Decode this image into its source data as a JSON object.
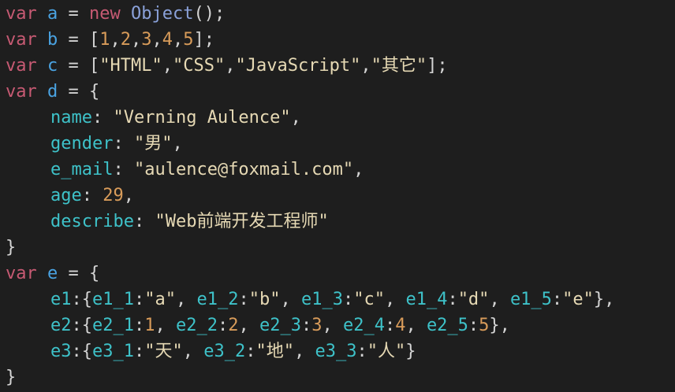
{
  "editor": {
    "background": "#1e1e1e",
    "colors": {
      "keyword": "#c75a73",
      "identifier": "#4aa3e2",
      "property": "#3ec2c9",
      "string": "#e6d9b4",
      "number": "#d99c5a",
      "punctuation": "#d4d4d4",
      "class": "#8aa1d9"
    },
    "lines": [
      {
        "indent": 0,
        "tokens": [
          {
            "t": "keyword",
            "v": "var"
          },
          {
            "t": "plain",
            "v": " "
          },
          {
            "t": "ident",
            "v": "a"
          },
          {
            "t": "plain",
            "v": " "
          },
          {
            "t": "punct",
            "v": "="
          },
          {
            "t": "plain",
            "v": " "
          },
          {
            "t": "keyword",
            "v": "new"
          },
          {
            "t": "plain",
            "v": " "
          },
          {
            "t": "class",
            "v": "Object"
          },
          {
            "t": "punct",
            "v": "();"
          }
        ]
      },
      {
        "indent": 0,
        "tokens": [
          {
            "t": "keyword",
            "v": "var"
          },
          {
            "t": "plain",
            "v": " "
          },
          {
            "t": "ident",
            "v": "b"
          },
          {
            "t": "plain",
            "v": " "
          },
          {
            "t": "punct",
            "v": "="
          },
          {
            "t": "plain",
            "v": " "
          },
          {
            "t": "punct",
            "v": "["
          },
          {
            "t": "number",
            "v": "1"
          },
          {
            "t": "punct",
            "v": ","
          },
          {
            "t": "number",
            "v": "2"
          },
          {
            "t": "punct",
            "v": ","
          },
          {
            "t": "number",
            "v": "3"
          },
          {
            "t": "punct",
            "v": ","
          },
          {
            "t": "number",
            "v": "4"
          },
          {
            "t": "punct",
            "v": ","
          },
          {
            "t": "number",
            "v": "5"
          },
          {
            "t": "punct",
            "v": "];"
          }
        ]
      },
      {
        "indent": 0,
        "tokens": [
          {
            "t": "keyword",
            "v": "var"
          },
          {
            "t": "plain",
            "v": " "
          },
          {
            "t": "ident",
            "v": "c"
          },
          {
            "t": "plain",
            "v": " "
          },
          {
            "t": "punct",
            "v": "="
          },
          {
            "t": "plain",
            "v": " "
          },
          {
            "t": "punct",
            "v": "["
          },
          {
            "t": "string",
            "v": "\"HTML\""
          },
          {
            "t": "punct",
            "v": ","
          },
          {
            "t": "string",
            "v": "\"CSS\""
          },
          {
            "t": "punct",
            "v": ","
          },
          {
            "t": "string",
            "v": "\"JavaScript\""
          },
          {
            "t": "punct",
            "v": ","
          },
          {
            "t": "string",
            "v": "\"其它\""
          },
          {
            "t": "punct",
            "v": "];"
          }
        ]
      },
      {
        "indent": 0,
        "tokens": [
          {
            "t": "keyword",
            "v": "var"
          },
          {
            "t": "plain",
            "v": " "
          },
          {
            "t": "ident",
            "v": "d"
          },
          {
            "t": "plain",
            "v": " "
          },
          {
            "t": "punct",
            "v": "="
          },
          {
            "t": "plain",
            "v": " "
          },
          {
            "t": "punct",
            "v": "{"
          }
        ]
      },
      {
        "indent": 1,
        "tokens": [
          {
            "t": "prop",
            "v": "name"
          },
          {
            "t": "punct",
            "v": ":"
          },
          {
            "t": "plain",
            "v": " "
          },
          {
            "t": "string",
            "v": "\"Verning Aulence\""
          },
          {
            "t": "punct",
            "v": ","
          }
        ]
      },
      {
        "indent": 1,
        "tokens": [
          {
            "t": "prop",
            "v": "gender"
          },
          {
            "t": "punct",
            "v": ":"
          },
          {
            "t": "plain",
            "v": " "
          },
          {
            "t": "string",
            "v": "\"男\""
          },
          {
            "t": "punct",
            "v": ","
          }
        ]
      },
      {
        "indent": 1,
        "tokens": [
          {
            "t": "prop",
            "v": "e_mail"
          },
          {
            "t": "punct",
            "v": ":"
          },
          {
            "t": "plain",
            "v": " "
          },
          {
            "t": "string",
            "v": "\"aulence@foxmail.com\""
          },
          {
            "t": "punct",
            "v": ","
          }
        ]
      },
      {
        "indent": 1,
        "tokens": [
          {
            "t": "prop",
            "v": "age"
          },
          {
            "t": "punct",
            "v": ":"
          },
          {
            "t": "plain",
            "v": " "
          },
          {
            "t": "number",
            "v": "29"
          },
          {
            "t": "punct",
            "v": ","
          }
        ]
      },
      {
        "indent": 1,
        "tokens": [
          {
            "t": "prop",
            "v": "describe"
          },
          {
            "t": "punct",
            "v": ":"
          },
          {
            "t": "plain",
            "v": " "
          },
          {
            "t": "string",
            "v": "\"Web前端开发工程师\""
          }
        ]
      },
      {
        "indent": 0,
        "tokens": [
          {
            "t": "punct",
            "v": "}"
          }
        ]
      },
      {
        "indent": 0,
        "tokens": [
          {
            "t": "keyword",
            "v": "var"
          },
          {
            "t": "plain",
            "v": " "
          },
          {
            "t": "ident",
            "v": "e"
          },
          {
            "t": "plain",
            "v": " "
          },
          {
            "t": "punct",
            "v": "="
          },
          {
            "t": "plain",
            "v": " "
          },
          {
            "t": "punct",
            "v": "{"
          }
        ]
      },
      {
        "indent": 1,
        "tokens": [
          {
            "t": "prop",
            "v": "e1"
          },
          {
            "t": "punct",
            "v": ":{"
          },
          {
            "t": "prop",
            "v": "e1_1"
          },
          {
            "t": "punct",
            "v": ":"
          },
          {
            "t": "string",
            "v": "\"a\""
          },
          {
            "t": "punct",
            "v": ", "
          },
          {
            "t": "prop",
            "v": "e1_2"
          },
          {
            "t": "punct",
            "v": ":"
          },
          {
            "t": "string",
            "v": "\"b\""
          },
          {
            "t": "punct",
            "v": ", "
          },
          {
            "t": "prop",
            "v": "e1_3"
          },
          {
            "t": "punct",
            "v": ":"
          },
          {
            "t": "string",
            "v": "\"c\""
          },
          {
            "t": "punct",
            "v": ", "
          },
          {
            "t": "prop",
            "v": "e1_4"
          },
          {
            "t": "punct",
            "v": ":"
          },
          {
            "t": "string",
            "v": "\"d\""
          },
          {
            "t": "punct",
            "v": ", "
          },
          {
            "t": "prop",
            "v": "e1_5"
          },
          {
            "t": "punct",
            "v": ":"
          },
          {
            "t": "string",
            "v": "\"e\""
          },
          {
            "t": "punct",
            "v": "},"
          }
        ]
      },
      {
        "indent": 1,
        "tokens": [
          {
            "t": "prop",
            "v": "e2"
          },
          {
            "t": "punct",
            "v": ":{"
          },
          {
            "t": "prop",
            "v": "e2_1"
          },
          {
            "t": "punct",
            "v": ":"
          },
          {
            "t": "number",
            "v": "1"
          },
          {
            "t": "punct",
            "v": ", "
          },
          {
            "t": "prop",
            "v": "e2_2"
          },
          {
            "t": "punct",
            "v": ":"
          },
          {
            "t": "number",
            "v": "2"
          },
          {
            "t": "punct",
            "v": ", "
          },
          {
            "t": "prop",
            "v": "e2_3"
          },
          {
            "t": "punct",
            "v": ":"
          },
          {
            "t": "number",
            "v": "3"
          },
          {
            "t": "punct",
            "v": ", "
          },
          {
            "t": "prop",
            "v": "e2_4"
          },
          {
            "t": "punct",
            "v": ":"
          },
          {
            "t": "number",
            "v": "4"
          },
          {
            "t": "punct",
            "v": ", "
          },
          {
            "t": "prop",
            "v": "e2_5"
          },
          {
            "t": "punct",
            "v": ":"
          },
          {
            "t": "number",
            "v": "5"
          },
          {
            "t": "punct",
            "v": "},"
          }
        ]
      },
      {
        "indent": 1,
        "tokens": [
          {
            "t": "prop",
            "v": "e3"
          },
          {
            "t": "punct",
            "v": ":{"
          },
          {
            "t": "prop",
            "v": "e3_1"
          },
          {
            "t": "punct",
            "v": ":"
          },
          {
            "t": "string",
            "v": "\"天\""
          },
          {
            "t": "punct",
            "v": ", "
          },
          {
            "t": "prop",
            "v": "e3_2"
          },
          {
            "t": "punct",
            "v": ":"
          },
          {
            "t": "string",
            "v": "\"地\""
          },
          {
            "t": "punct",
            "v": ", "
          },
          {
            "t": "prop",
            "v": "e3_3"
          },
          {
            "t": "punct",
            "v": ":"
          },
          {
            "t": "string",
            "v": "\"人\""
          },
          {
            "t": "punct",
            "v": "}"
          }
        ]
      },
      {
        "indent": 0,
        "tokens": [
          {
            "t": "punct",
            "v": "}"
          }
        ]
      }
    ]
  }
}
